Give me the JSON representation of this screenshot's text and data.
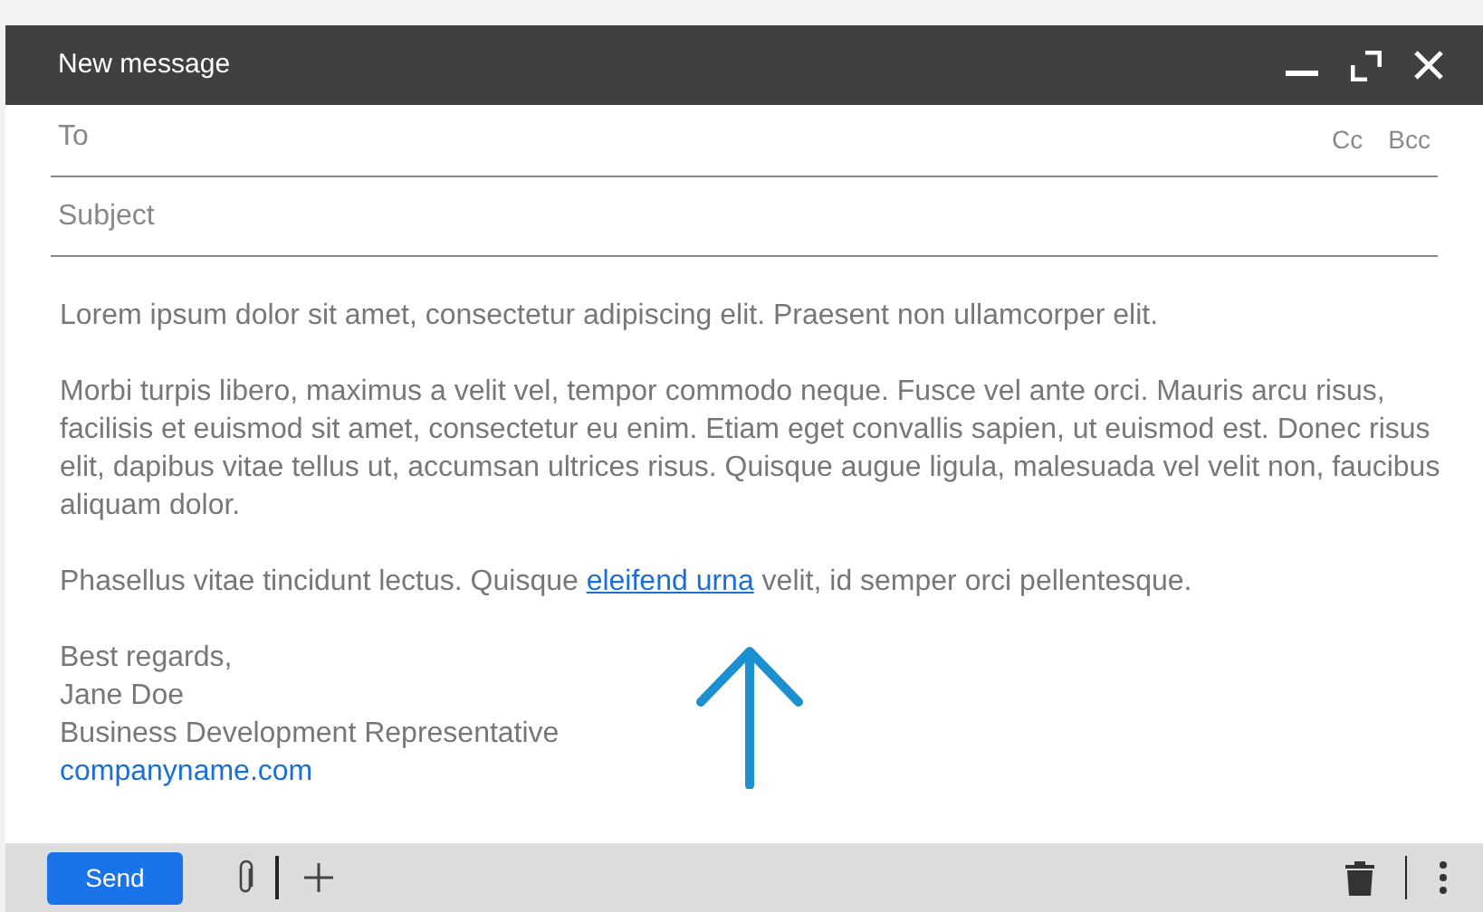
{
  "window": {
    "title": "New message"
  },
  "fields": {
    "to": {
      "placeholder": "To"
    },
    "cc": "Cc",
    "bcc": "Bcc",
    "subject": {
      "placeholder": "Subject"
    }
  },
  "body": {
    "paragraphs": [
      "Lorem ipsum dolor sit amet, consectetur adipiscing elit. Praesent non ullamcorper elit.",
      "Morbi turpis libero, maximus a velit vel, tempor commodo neque. Fusce vel ante orci. Mauris arcu risus, facilisis et euismod sit amet, consectetur eu enim. Etiam eget convallis sapien, ut euismod est. Donec risus elit, dapibus vitae tellus ut, accumsan ultrices risus. Quisque augue ligula, malesuada vel velit non, faucibus aliquam dolor."
    ],
    "link_paragraph": {
      "before": "Phasellus vitae tincidunt lectus. Quisque ",
      "link": "eleifend urna",
      "after": " velit, id semper orci pellentesque."
    },
    "signature": [
      "Best regards,",
      "Jane Doe",
      "Business Development Representative"
    ],
    "signature_link": "companyname.com"
  },
  "footer": {
    "send": "Send"
  }
}
